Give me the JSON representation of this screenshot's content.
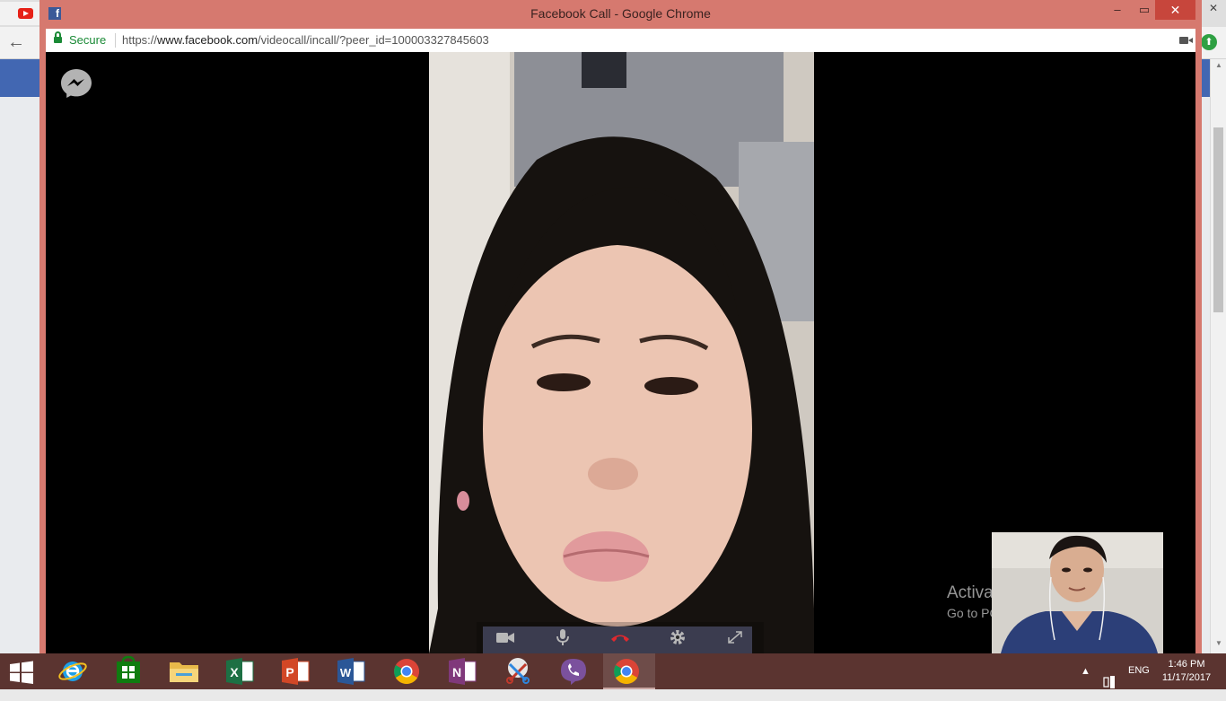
{
  "window": {
    "title": "Facebook Call - Google Chrome",
    "minimize_label": "–",
    "maximize_label": "▭",
    "close_label": "✕"
  },
  "addressbar": {
    "secure_label": "Secure",
    "url_scheme": "https://",
    "url_host": "www.facebook.com",
    "url_path": "/videocall/incall/?peer_id=100003327845603"
  },
  "background_browser": {
    "back_icon": "←",
    "close_label": "✕"
  },
  "watermark": {
    "line1": "Activate Windows",
    "line2": "Go to PC settings to activate Windows."
  },
  "call_controls": [
    {
      "name": "video-camera-icon"
    },
    {
      "name": "microphone-icon"
    },
    {
      "name": "end-call-icon",
      "color": "#e0282e"
    },
    {
      "name": "settings-gear-icon"
    },
    {
      "name": "fullscreen-icon"
    }
  ],
  "taskbar": {
    "apps": [
      {
        "name": "internet-explorer-icon"
      },
      {
        "name": "windows-store-icon"
      },
      {
        "name": "file-explorer-icon"
      },
      {
        "name": "excel-icon"
      },
      {
        "name": "powerpoint-icon"
      },
      {
        "name": "word-icon"
      },
      {
        "name": "chrome-icon"
      },
      {
        "name": "onenote-icon"
      },
      {
        "name": "snipping-tool-icon"
      },
      {
        "name": "viber-icon"
      },
      {
        "name": "chrome-active-icon"
      }
    ],
    "language": "ENG",
    "time": "1:46 PM",
    "date": "11/17/2017"
  }
}
